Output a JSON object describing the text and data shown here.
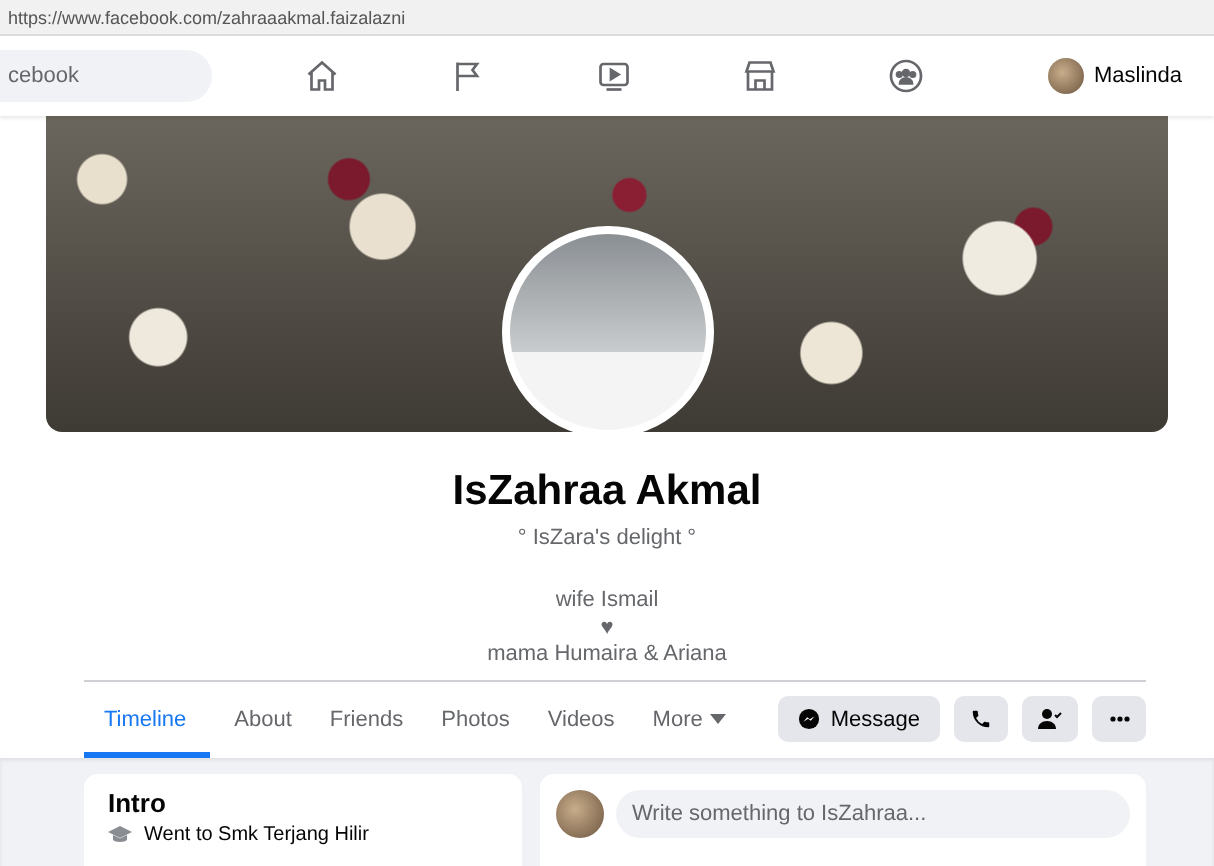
{
  "browser": {
    "url": "https://www.facebook.com/zahraaakmal.faizalazni"
  },
  "top_nav": {
    "search": {
      "placeholder": "cebook"
    },
    "account": {
      "name": "Maslinda"
    }
  },
  "profile": {
    "name": "IsZahraa Akmal",
    "tagline": "° IsZara's delight °",
    "bio": [
      "wife Ismail",
      "♥",
      "mama Humaira & Ariana"
    ]
  },
  "tabs": [
    {
      "label": "Timeline",
      "kind": "link",
      "selected": true
    },
    {
      "label": "About",
      "kind": "link",
      "selected": false
    },
    {
      "label": "Friends",
      "kind": "link",
      "selected": false
    },
    {
      "label": "Photos",
      "kind": "link",
      "selected": false
    },
    {
      "label": "Videos",
      "kind": "link",
      "selected": false
    },
    {
      "label": "More",
      "kind": "dropdown",
      "selected": false
    }
  ],
  "actions": [
    {
      "kind": "message",
      "label": "Message"
    },
    {
      "kind": "call"
    },
    {
      "kind": "friends"
    },
    {
      "kind": "more"
    }
  ],
  "intro": {
    "title": "Intro",
    "items": [
      {
        "kind": "education",
        "text": "Went to Smk Terjang Hilir"
      }
    ]
  },
  "composer": {
    "placeholder": "Write something to IsZahraa..."
  }
}
